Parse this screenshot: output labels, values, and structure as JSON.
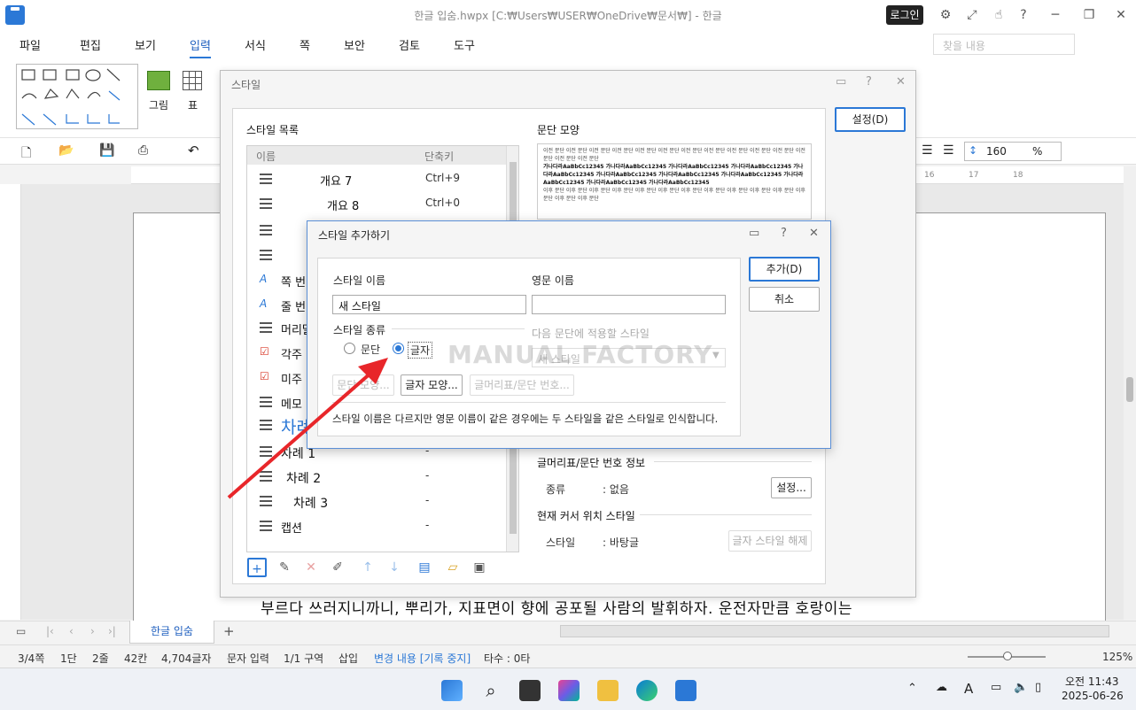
{
  "window": {
    "title": "한글 입숨.hwpx [C:₩Users₩USER₩OneDrive₩문서₩] - 한글",
    "login": "로그인"
  },
  "menu": {
    "items": [
      "파일",
      "편집",
      "보기",
      "입력",
      "서식",
      "쪽",
      "보안",
      "검토",
      "도구"
    ],
    "search_placeholder": "찾을 내용"
  },
  "ribbon": {
    "picture": "그림",
    "table": "표",
    "zoom_value": "160",
    "unit": "%"
  },
  "ruler_labels": [
    "16",
    "17",
    "18"
  ],
  "document": {
    "line": "부르다 쓰러지니까니, 뿌리가, 지표면이 향에 공포될 사람의 발휘하자. 운전자만큼 호랑이는"
  },
  "style_dialog": {
    "title": "스타일",
    "list_title": "스타일 목록",
    "col_name": "이름",
    "col_key": "단축키",
    "rows": [
      {
        "name": "개요 7",
        "key": "Ctrl+9"
      },
      {
        "name": "개요 8",
        "key": "Ctrl+0"
      },
      {
        "name": "",
        "key": ""
      },
      {
        "name": "",
        "key": ""
      },
      {
        "name": "쪽 번",
        "key": ""
      },
      {
        "name": "줄 번",
        "key": ""
      },
      {
        "name": "머리말",
        "key": ""
      },
      {
        "name": "각주",
        "key": ""
      },
      {
        "name": "미주",
        "key": ""
      },
      {
        "name": "메모",
        "key": ""
      },
      {
        "name": "차례",
        "key": ""
      },
      {
        "name": "차례 1",
        "key": "-"
      },
      {
        "name": "차례 2",
        "key": "-"
      },
      {
        "name": "차례 3",
        "key": "-"
      },
      {
        "name": "캡션",
        "key": "-"
      }
    ],
    "para_shape": "문단 모양",
    "preview_prev": "이전 문단 이전 문단 이전 문단 이전 문단 이전 문단 이전 문단 이전 문단 이전 문단 이전 문단 이전 문단 이전 문단 이전 문단 이전 문단 이전 문단",
    "preview_main": "가나다라AaBbCc12345 가나다라AaBbCc12345 가나다라AaBbCc12345 가나다라AaBbCc12345 가나다라AaBbCc12345 가나다라AaBbCc12345 가나다라AaBbCc12345 가나다라AaBbCc12345 가나다라AaBbCc12345 가나다라AaBbCc12345 가나다라AaBbCc12345",
    "preview_next": "이후 문단 이후 문단 이후 문단 이후 문단 이후 문단 이후 문단 이후 문단 이후 문단 이후 문단 이후 문단 이후 문단 이후 문단 이후 문단 이후 문단",
    "settings_button": "설정(D)",
    "numbering_section": "글머리표/문단 번호 정보",
    "kind_label": "종류",
    "kind_value": ": 없음",
    "numbering_settings": "설정...",
    "cursor_section": "현재 커서 위치 스타일",
    "style_label": "스타일",
    "style_value": ": 바탕글",
    "release_button": "글자 스타일 해제"
  },
  "add_dialog": {
    "title": "스타일 추가하기",
    "name_label": "스타일 이름",
    "name_value": "새 스타일",
    "en_label": "영문 이름",
    "en_value": "",
    "kind_label": "스타일 종류",
    "radio_para": "문단",
    "radio_char": "글자",
    "next_label": "다음 문단에 적용할 스타일",
    "next_value": "새 스타일",
    "btn_para_shape": "문단 모양...",
    "btn_char_shape": "글자 모양...",
    "btn_numbering": "글머리표/문단 번호...",
    "note": "스타일 이름은 다르지만 영문 이름이 같은 경우에는 두 스타일을 같은 스타일로 인식합니다.",
    "add_button": "추가(D)",
    "cancel_button": "취소"
  },
  "watermark": "MANUAL FACTORY",
  "tabs": {
    "doc_tab": "한글 입숨"
  },
  "status": {
    "page": "3/4쪽",
    "col": "1단",
    "line": "2줄",
    "pos": "42칸",
    "chars": "4,704글자",
    "mode": "문자 입력",
    "section": "1/1 구역",
    "insert": "삽입",
    "track": "변경 내용 [기록 중지]",
    "keys": "타수 : 0타",
    "zoom": "125%"
  },
  "taskbar": {
    "ime": "A",
    "time": "오전 11:43",
    "date": "2025-06-26"
  },
  "colors": {
    "accent": "#2b78d6",
    "arrow": "#e8262a"
  }
}
